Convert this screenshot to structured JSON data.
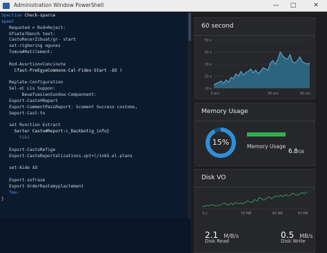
{
  "window": {
    "title": "Administration Window PowerShell",
    "min_glyph": "—",
    "max_glyph": "□",
    "close_glyph": "✕"
  },
  "terminal": {
    "lines": [
      {
        "text": "Spection Check-sparce",
        "style": "blue-white",
        "prefix": "Spection"
      },
      {
        "text": "speel",
        "style": "blue"
      },
      {
        "text": "   Requoted > Rod=Roject:",
        "style": "normal"
      },
      {
        "text": "   Ofsete?Dench text:",
        "style": "normal"
      },
      {
        "text": "   CastoRecerZibuat/gr- start",
        "style": "normal"
      },
      {
        "text": "   set-righering ogunes",
        "style": "normal"
      },
      {
        "text": "   Tomce#Retilement:",
        "style": "normal"
      },
      {
        "text": "",
        "style": "normal"
      },
      {
        "text": "   Rod-Avortion>Concinute",
        "style": "normal"
      },
      {
        "text": "     Cfast-PreEgyeCommone-Cal-Fidex-Start -£O )",
        "style": "white"
      },
      {
        "text": "",
        "style": "normal"
      },
      {
        "text": "   Replate-Configuration",
        "style": "normal"
      },
      {
        "text": "   Sel-oC Lis Suppon:",
        "style": "normal"
      },
      {
        "text": "        BeuefuasienSundow-Compannent:",
        "style": "normal"
      },
      {
        "text": "   Export-Casto®Repart",
        "style": "normal"
      },
      {
        "text": "   Export-CommentPassReport: Scoment Success costoms,",
        "style": "normal"
      },
      {
        "text": "   Seport-Cast-to",
        "style": "normal"
      },
      {
        "text": "",
        "style": "normal"
      },
      {
        "text": "   set Runction Extract",
        "style": "normal"
      },
      {
        "text": "     Serter Casto#Report:c_Dackbotig_info}",
        "style": "white"
      },
      {
        "text": "       tiki",
        "style": "dim"
      },
      {
        "text": "",
        "style": "normal"
      },
      {
        "text": "   Export-CastoRefige",
        "style": "normal"
      },
      {
        "text": "   Export-CastoReportalizations.opt+(/ink5-el.plans",
        "style": "normal"
      },
      {
        "text": "",
        "style": "normal"
      },
      {
        "text": "   set-kide £O",
        "style": "normal"
      },
      {
        "text": "",
        "style": "normal"
      },
      {
        "text": "   Export-sofrase",
        "style": "normal"
      },
      {
        "text": "   Export OrderRastamyplactement",
        "style": "normal"
      },
      {
        "text": "   fee:",
        "style": "blue"
      },
      {
        "text": "}",
        "style": "cursor"
      }
    ]
  },
  "panels": {
    "network": {
      "title": "60 second",
      "y_ticks": [
        "50 x",
        "40 x",
        "30 x",
        "20 x",
        "10 x"
      ],
      "x_ticks": [
        "0 acc",
        "60 acc",
        "60 acc"
      ],
      "line_color": "#5fb0dc",
      "fill_color": "#2f6e8c"
    },
    "memory": {
      "title": "Memory Usage",
      "percent_label": "15%",
      "usage_percent": 15,
      "label": "Memory Usage",
      "value": "6.8",
      "unit": "GB",
      "ring_color": "#2f8fd8",
      "bar_color": "#2eb24f",
      "bar_fraction": 1.0
    },
    "disk": {
      "title": "Disk VO",
      "x_ticks": [
        "0 x",
        "55 MB",
        "60 MB",
        "53 MB"
      ],
      "line_color": "#2fa84e",
      "read_value": "2.1",
      "read_unit": "M/B/s",
      "read_label": "Disk Read",
      "write_value": "0.5",
      "write_unit": "MB/s",
      "write_label": "Disk Write"
    }
  },
  "chart_data": [
    {
      "type": "area",
      "title": "60 second",
      "x_tick_labels": [
        "0 acc",
        "60 acc",
        "60 acc"
      ],
      "y_tick_labels": [
        "50 x",
        "40 x",
        "30 x",
        "20 x",
        "10 x"
      ],
      "ylim": [
        10,
        50
      ],
      "x": [
        0,
        1,
        2,
        3,
        4,
        5,
        6,
        7,
        8,
        9,
        10,
        11,
        12,
        13,
        14,
        15,
        16,
        17,
        18,
        19,
        20,
        21,
        22,
        23,
        24,
        25,
        26,
        27,
        28,
        29,
        30,
        31,
        32,
        33,
        34,
        35,
        36,
        37,
        38,
        39
      ],
      "values": [
        13,
        14,
        15,
        16,
        14,
        17,
        15,
        19,
        18,
        22,
        20,
        24,
        21,
        23,
        24,
        26,
        23,
        25,
        22,
        24,
        27,
        26,
        25,
        31,
        33,
        30,
        34,
        40,
        37,
        35,
        34,
        38,
        32,
        31,
        33,
        36,
        32,
        31,
        30,
        31
      ]
    },
    {
      "type": "line",
      "title": "Disk VO",
      "x_tick_labels": [
        "0 x",
        "55 MB",
        "60 MB",
        "53 MB"
      ],
      "values": [
        12,
        11,
        13,
        12,
        14,
        13,
        12,
        13,
        14,
        16,
        15,
        13,
        16,
        14,
        17,
        15,
        16,
        15,
        17,
        19,
        18,
        17,
        21,
        19,
        24,
        22,
        20,
        23,
        25,
        22,
        24,
        26,
        25,
        27,
        25,
        28,
        26,
        27,
        30,
        28,
        27,
        29,
        31,
        29,
        32
      ]
    }
  ]
}
